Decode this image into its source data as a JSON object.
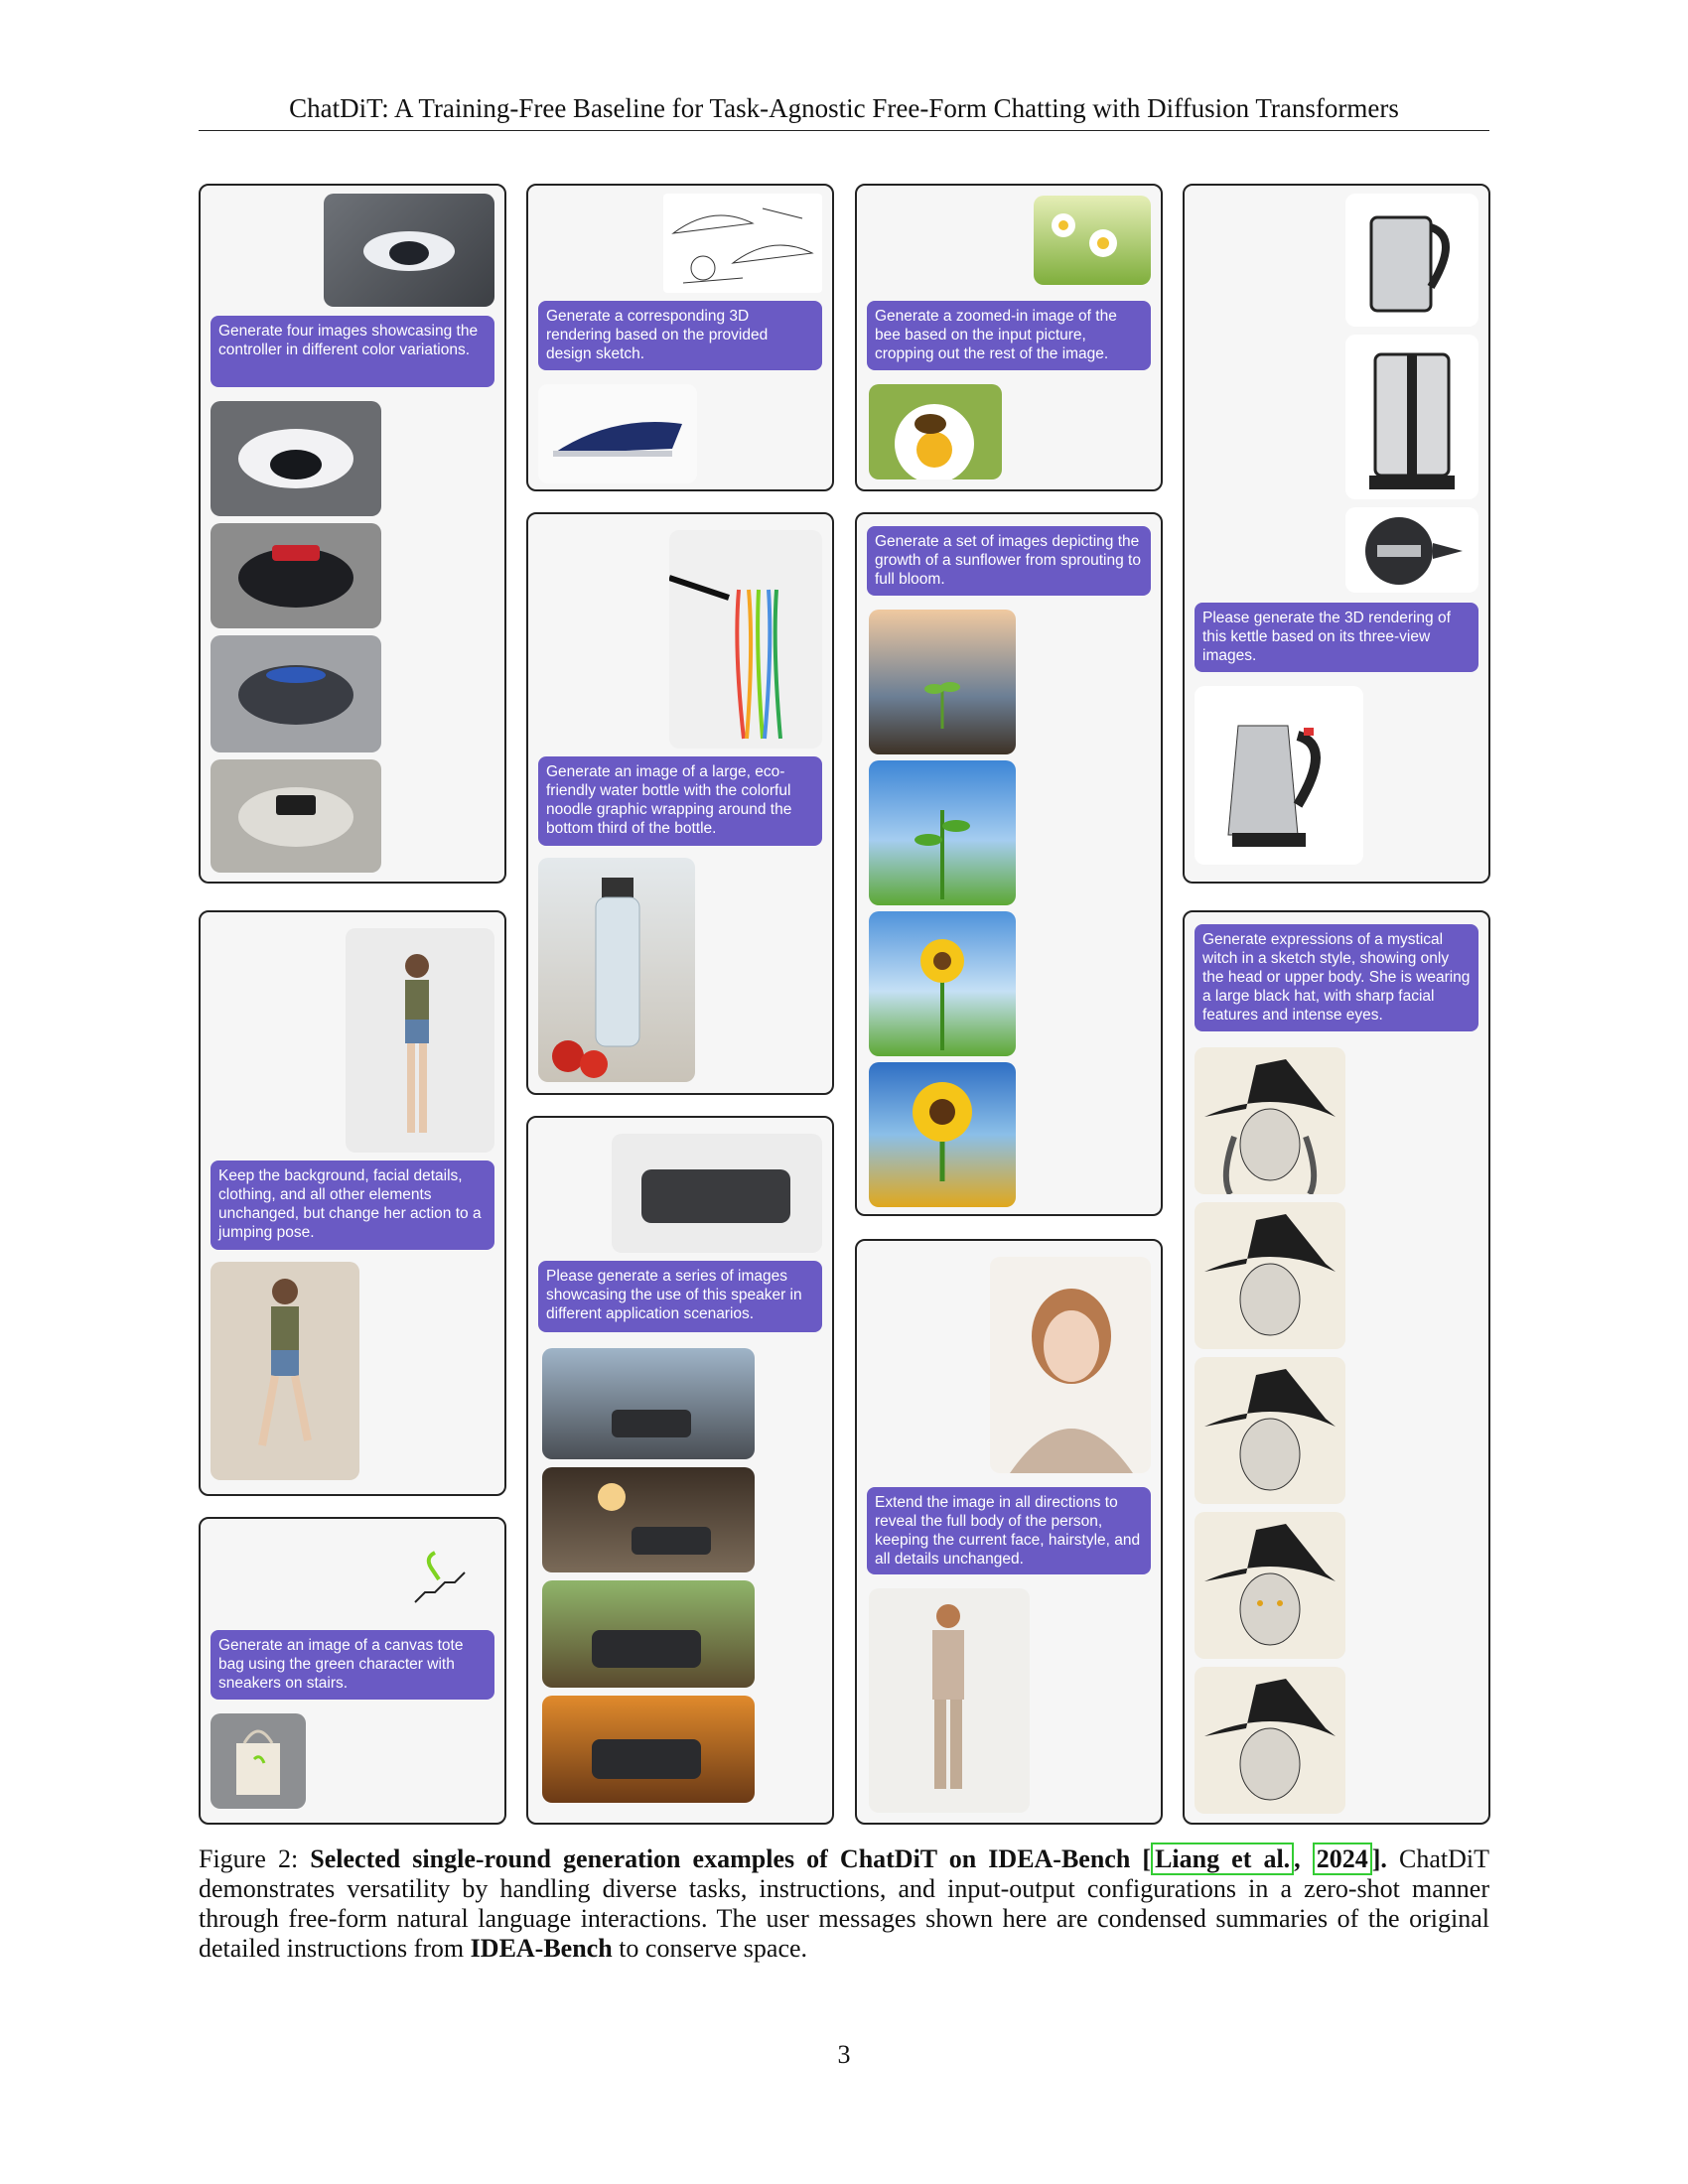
{
  "header": {
    "title": "ChatDiT: A Training-Free Baseline for Task-Agnostic Free-Form Chatting with Diffusion Transformers"
  },
  "panels": {
    "p1": {
      "prompt": "Generate four images showcasing the controller in different color variations."
    },
    "p2": {
      "prompt": "Keep the background, facial details, clothing, and all other elements unchanged, but change her action to a jumping pose."
    },
    "p3": {
      "prompt": "Generate an image of a canvas tote bag using the green character with sneakers on stairs."
    },
    "p4": {
      "prompt": "Generate a corresponding 3D rendering based on the provided design sketch."
    },
    "p5": {
      "prompt": "Generate an image of a large, eco-friendly water bottle with the colorful noodle graphic wrapping around the bottom third of the bottle."
    },
    "p6": {
      "prompt": "Please generate a series of images showcasing the use of this speaker in different application scenarios."
    },
    "p7": {
      "prompt": "Generate a zoomed-in image of the bee based on the input picture, cropping out the rest of the image."
    },
    "p8": {
      "prompt": "Generate a set of images depicting the growth of a sunflower from sprouting to full bloom."
    },
    "p9": {
      "prompt": "Extend the image in all directions to reveal the full body of the person, keeping the current face, hairstyle, and all details unchanged."
    },
    "p10": {
      "prompt": "Please generate the 3D rendering of this kettle based on its three-view images."
    },
    "p11": {
      "prompt": "Generate expressions of a mystical witch in a sketch style, showing only the head or upper body. She is wearing a large black hat, with sharp facial features and intense eyes."
    }
  },
  "caption": {
    "label": "Figure 2:",
    "bold": "Selected single-round generation examples of ChatDiT on IDEA-Bench",
    "cite_open": "[",
    "cite_author": "Liang et al.",
    "cite_sep": ", ",
    "cite_year": "2024",
    "cite_close": "].",
    "text1": " ChatDiT demonstrates versatility by handling diverse tasks, instructions, and input-output configurations in a zero-shot manner through free-form natural language interactions. The user messages shown here are condensed summaries of the original detailed instructions from ",
    "bench": "IDEA-Bench",
    "text2": " to conserve space."
  },
  "page_number": "3"
}
